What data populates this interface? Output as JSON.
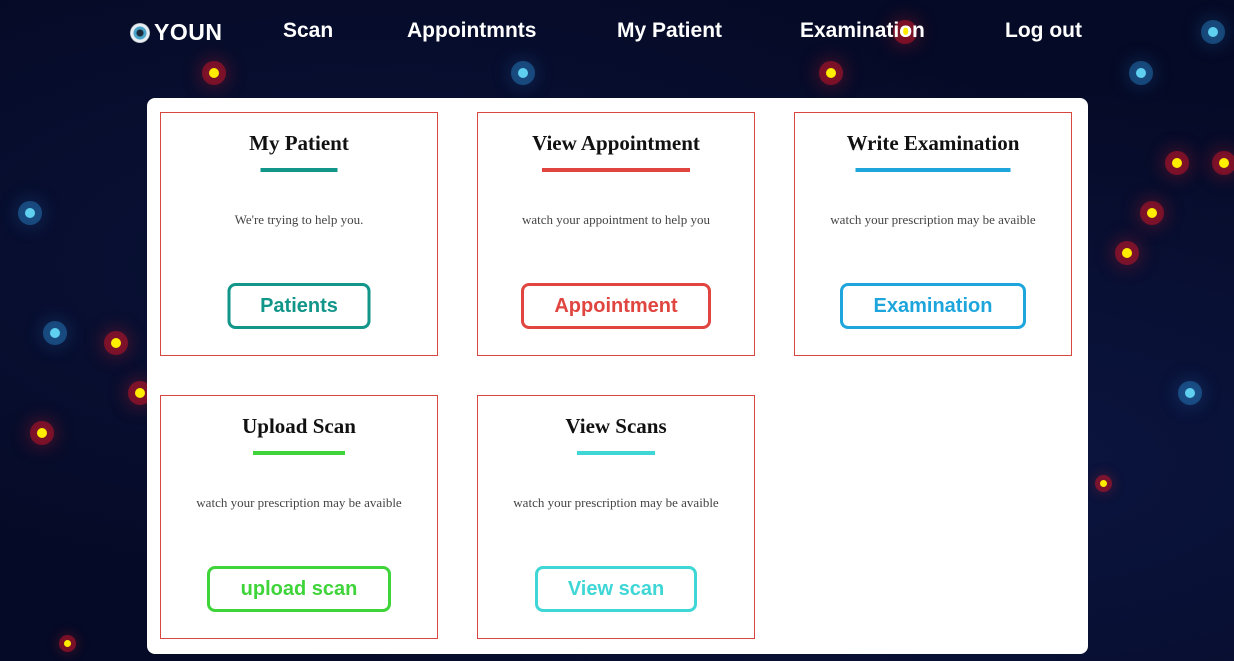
{
  "nav": {
    "brand": "YOUN",
    "links": [
      "Scan",
      "Appointmnts",
      "My Patient",
      "Examination",
      "Log out"
    ]
  },
  "cards": [
    {
      "title": "My Patient",
      "desc": "We're trying to help you.",
      "button": "Patients",
      "color": "#13968a"
    },
    {
      "title": "View Appointment",
      "desc": "watch your appointment to help you",
      "button": "Appointment",
      "color": "#e0463f"
    },
    {
      "title": "Write Examination",
      "desc": "watch your prescription may be avaible",
      "button": "Examination",
      "color": "#1ea6dc"
    },
    {
      "title": "Upload Scan",
      "desc": "watch your prescription may be avaible",
      "button": "upload scan",
      "color": "#3fd43a"
    },
    {
      "title": "View Scans",
      "desc": "watch your prescription may be avaible",
      "button": "View scan",
      "color": "#3fd6d6"
    }
  ]
}
